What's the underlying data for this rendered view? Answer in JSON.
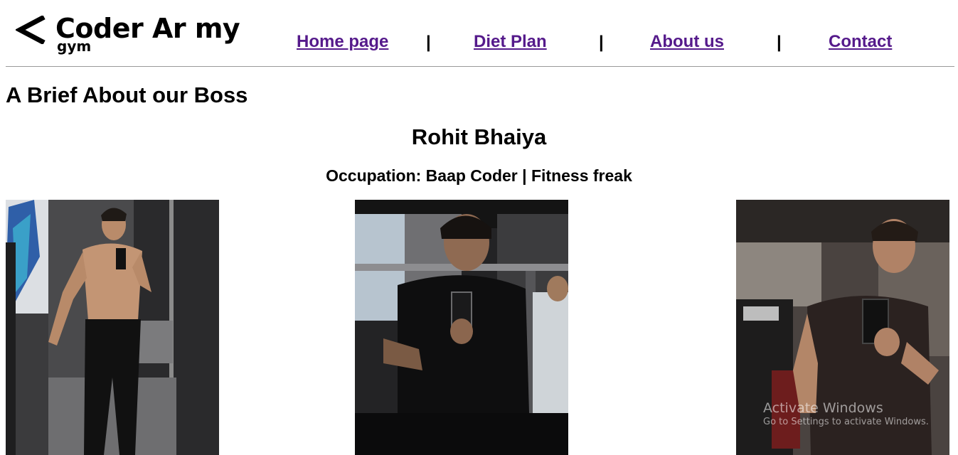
{
  "header": {
    "logo": {
      "main": "Coder Ar my",
      "sub": "gym",
      "icon": "chevron-left-icon"
    },
    "nav": [
      {
        "label": "Home page"
      },
      {
        "label": "Diet Plan"
      },
      {
        "label": "About us"
      },
      {
        "label": "Contact"
      }
    ],
    "separator": "|",
    "link_color": "#551a8b"
  },
  "main": {
    "heading": "A Brief About our Boss",
    "name": "Rohit Bhaiya",
    "occupation": "Occupation: Baap Coder | Fitness freak"
  },
  "photos": [
    {
      "subject": "shirtless gym mirror selfie"
    },
    {
      "subject": "seated gym selfie in black t-shirt"
    },
    {
      "subject": "gym mirror selfie in dark t-shirt"
    }
  ],
  "os_watermark": {
    "line1": "Activate Windows",
    "line2": "Go to Settings to activate Windows."
  }
}
